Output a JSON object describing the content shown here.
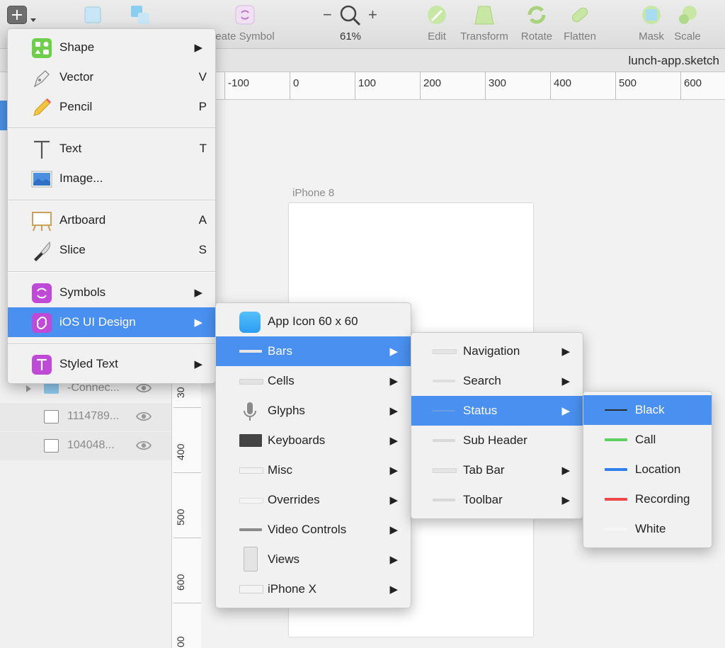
{
  "toolbar": {
    "items": [
      {
        "label": "eate Symbol"
      },
      {
        "label": "Edit"
      },
      {
        "label": "Transform"
      },
      {
        "label": "Rotate"
      },
      {
        "label": "Flatten"
      },
      {
        "label": "Mask"
      },
      {
        "label": "Scale"
      }
    ],
    "zoom": {
      "minus": "−",
      "plus": "+",
      "value": "61%"
    }
  },
  "document": {
    "title": "lunch-app.sketch"
  },
  "ruler": {
    "h_labels": [
      "-100",
      "0",
      "100",
      "200",
      "300",
      "400",
      "500",
      "600"
    ],
    "v_labels": [
      "30",
      "400",
      "500",
      "600",
      "00"
    ]
  },
  "artboard": {
    "label": "iPhone 8"
  },
  "layers": [
    {
      "name": "-Connec...",
      "type": "folder"
    },
    {
      "name": "1114789...",
      "type": "image"
    },
    {
      "name": "104048...",
      "type": "image"
    }
  ],
  "insert_menu": {
    "items": [
      {
        "label": "Shape",
        "shortcut": "",
        "submenu": true
      },
      {
        "label": "Vector",
        "shortcut": "V"
      },
      {
        "label": "Pencil",
        "shortcut": "P"
      },
      {
        "label": "Text",
        "shortcut": "T"
      },
      {
        "label": "Image...",
        "shortcut": ""
      },
      {
        "label": "Artboard",
        "shortcut": "A"
      },
      {
        "label": "Slice",
        "shortcut": "S"
      },
      {
        "label": "Symbols",
        "submenu": true
      },
      {
        "label": "iOS UI Design",
        "submenu": true,
        "selected": true
      },
      {
        "label": "Styled Text",
        "submenu": true
      }
    ],
    "arrow": "▶"
  },
  "ios_menu": {
    "items": [
      {
        "label": "App Icon 60 x 60"
      },
      {
        "label": "Bars",
        "selected": true
      },
      {
        "label": "Cells"
      },
      {
        "label": "Glyphs"
      },
      {
        "label": "Keyboards"
      },
      {
        "label": "Misc"
      },
      {
        "label": "Overrides"
      },
      {
        "label": "Video Controls"
      },
      {
        "label": "Views"
      },
      {
        "label": "iPhone X"
      }
    ]
  },
  "bars_menu": {
    "items": [
      {
        "label": "Navigation"
      },
      {
        "label": "Search"
      },
      {
        "label": "Status",
        "selected": true
      },
      {
        "label": "Sub Header"
      },
      {
        "label": "Tab Bar"
      },
      {
        "label": "Toolbar"
      }
    ]
  },
  "status_menu": {
    "items": [
      {
        "label": "Black",
        "color": "#2a2a2a",
        "selected": true
      },
      {
        "label": "Call",
        "color": "#5fcf5f"
      },
      {
        "label": "Location",
        "color": "#2f80ed"
      },
      {
        "label": "Recording",
        "color": "#f04848"
      },
      {
        "label": "White",
        "color": "#f5f5f5"
      }
    ]
  },
  "colors": {
    "accent": "#4a90f0"
  }
}
